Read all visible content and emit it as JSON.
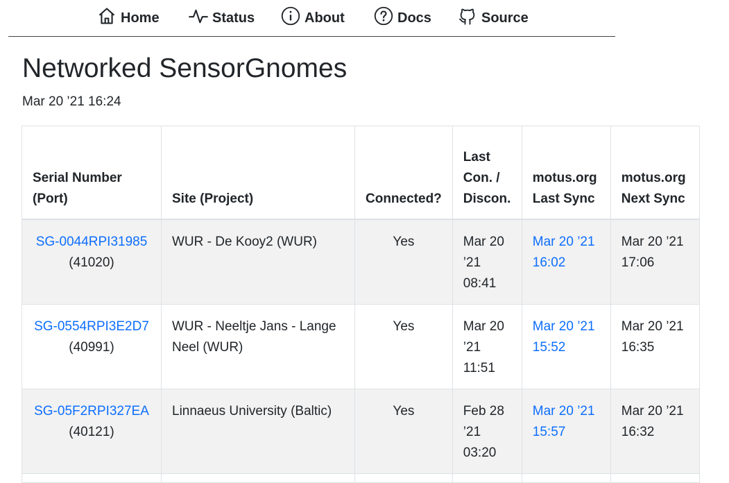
{
  "nav": {
    "home": {
      "label": "Home",
      "icon": "home-icon"
    },
    "status": {
      "label": "Status",
      "icon": "pulse-icon"
    },
    "about": {
      "label": "About",
      "icon": "info-icon"
    },
    "docs": {
      "label": "Docs",
      "icon": "help-icon"
    },
    "source": {
      "label": "Source",
      "icon": "github-icon"
    }
  },
  "page": {
    "title": "Networked SensorGnomes",
    "timestamp": "Mar 20 ’21 16:24"
  },
  "table": {
    "headers": {
      "serial_line1": "Serial Number",
      "serial_line2": "(Port)",
      "site": "Site (Project)",
      "connected": "Connected?",
      "lastcon_line1": "Last",
      "lastcon_line2": "Con. /",
      "lastcon_line3": "Discon.",
      "lastsync_line1": "motus.org",
      "lastsync_line2": "Last Sync",
      "nextsync_line1": "motus.org",
      "nextsync_line2": "Next Sync"
    },
    "rows": [
      {
        "serial": "SG-0044RPI31985",
        "port": "(41020)",
        "site": "WUR - De Kooy2 (WUR)",
        "connected": "Yes",
        "lastcon_l1": "Mar 20",
        "lastcon_l2": "’21",
        "lastcon_l3": "08:41",
        "lastsync_l1": "Mar 20 ’21",
        "lastsync_l2": "16:02",
        "nextsync_l1": "Mar 20 ’21",
        "nextsync_l2": "17:06"
      },
      {
        "serial": "SG-0554RPI3E2D7",
        "port": "(40991)",
        "site": "WUR - Neeltje Jans - Lange Neel (WUR)",
        "connected": "Yes",
        "lastcon_l1": "Mar 20",
        "lastcon_l2": "’21",
        "lastcon_l3": "11:51",
        "lastsync_l1": "Mar 20 ’21",
        "lastsync_l2": "15:52",
        "nextsync_l1": "Mar 20 ’21",
        "nextsync_l2": "16:35"
      },
      {
        "serial": "SG-05F2RPI327EA",
        "port": "(40121)",
        "site": "Linnaeus University (Baltic)",
        "connected": "Yes",
        "lastcon_l1": "Feb 28",
        "lastcon_l2": "’21",
        "lastcon_l3": "03:20",
        "lastsync_l1": "Mar 20 ’21",
        "lastsync_l2": "15:57",
        "nextsync_l1": "Mar 20 ’21",
        "nextsync_l2": "16:32"
      }
    ]
  },
  "colors": {
    "link": "#0d6efd",
    "stripe": "#f2f2f2",
    "border": "#dee2e6"
  }
}
